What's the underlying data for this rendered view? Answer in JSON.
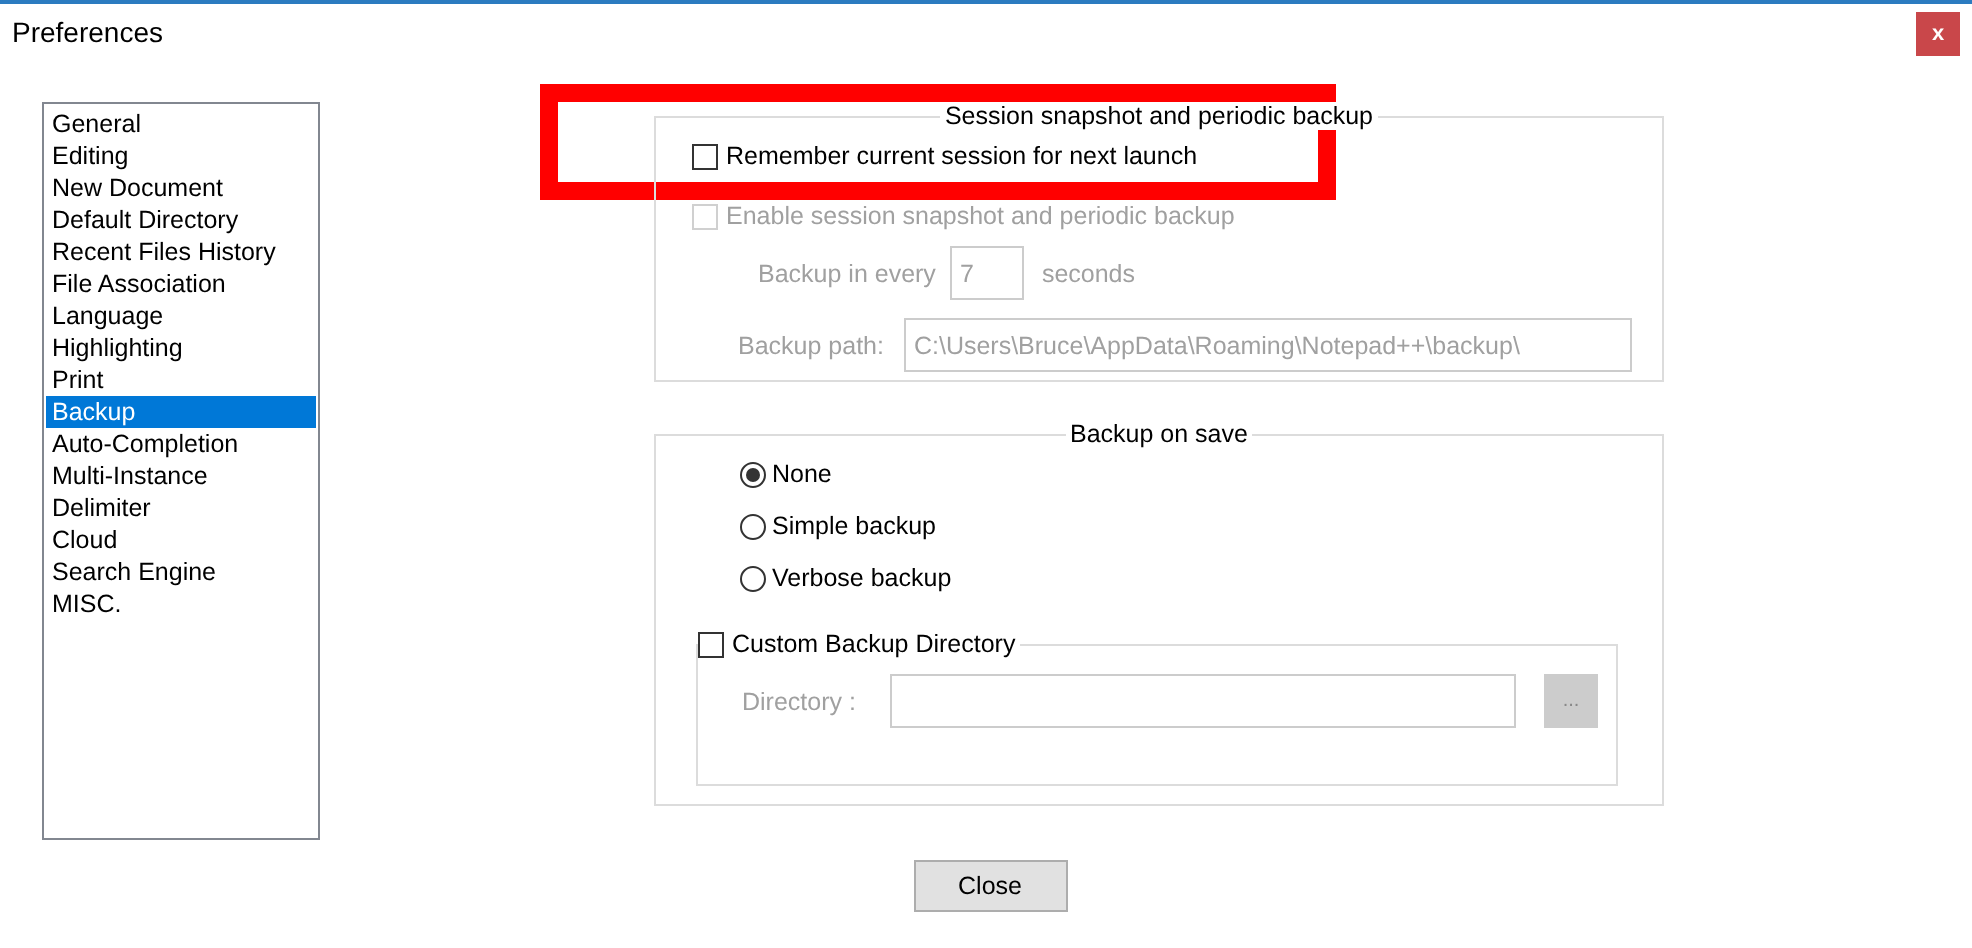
{
  "window": {
    "title": "Preferences",
    "close": "x"
  },
  "sidebar": {
    "items": [
      {
        "label": "General",
        "selected": false
      },
      {
        "label": "Editing",
        "selected": false
      },
      {
        "label": "New Document",
        "selected": false
      },
      {
        "label": "Default Directory",
        "selected": false
      },
      {
        "label": "Recent Files History",
        "selected": false
      },
      {
        "label": "File Association",
        "selected": false
      },
      {
        "label": "Language",
        "selected": false
      },
      {
        "label": "Highlighting",
        "selected": false
      },
      {
        "label": "Print",
        "selected": false
      },
      {
        "label": "Backup",
        "selected": true
      },
      {
        "label": "Auto-Completion",
        "selected": false
      },
      {
        "label": "Multi-Instance",
        "selected": false
      },
      {
        "label": "Delimiter",
        "selected": false
      },
      {
        "label": "Cloud",
        "selected": false
      },
      {
        "label": "Search Engine",
        "selected": false
      },
      {
        "label": "MISC.",
        "selected": false
      }
    ]
  },
  "session_group": {
    "title": "Session snapshot and periodic backup",
    "remember": {
      "label": "Remember current session for next launch",
      "checked": false,
      "disabled": false
    },
    "enable_snapshot": {
      "label": "Enable session snapshot and periodic backup",
      "checked": false,
      "disabled": true
    },
    "interval": {
      "label": "Backup in every",
      "value": "7",
      "unit": "seconds",
      "disabled": true
    },
    "path": {
      "label": "Backup path:",
      "value": "C:\\Users\\Bruce\\AppData\\Roaming\\Notepad++\\backup\\",
      "disabled": true
    }
  },
  "backup_on_save": {
    "title": "Backup on save",
    "options": [
      {
        "label": "None",
        "selected": true
      },
      {
        "label": "Simple backup",
        "selected": false
      },
      {
        "label": "Verbose backup",
        "selected": false
      }
    ],
    "custom_directory": {
      "label": "Custom Backup Directory",
      "checked": false,
      "disabled": false
    },
    "directory": {
      "label": "Directory :",
      "browse": "...",
      "disabled": true
    }
  },
  "buttons": [
    {
      "label": "Close"
    }
  ],
  "annotation": {
    "kind": "highlight-frame"
  }
}
